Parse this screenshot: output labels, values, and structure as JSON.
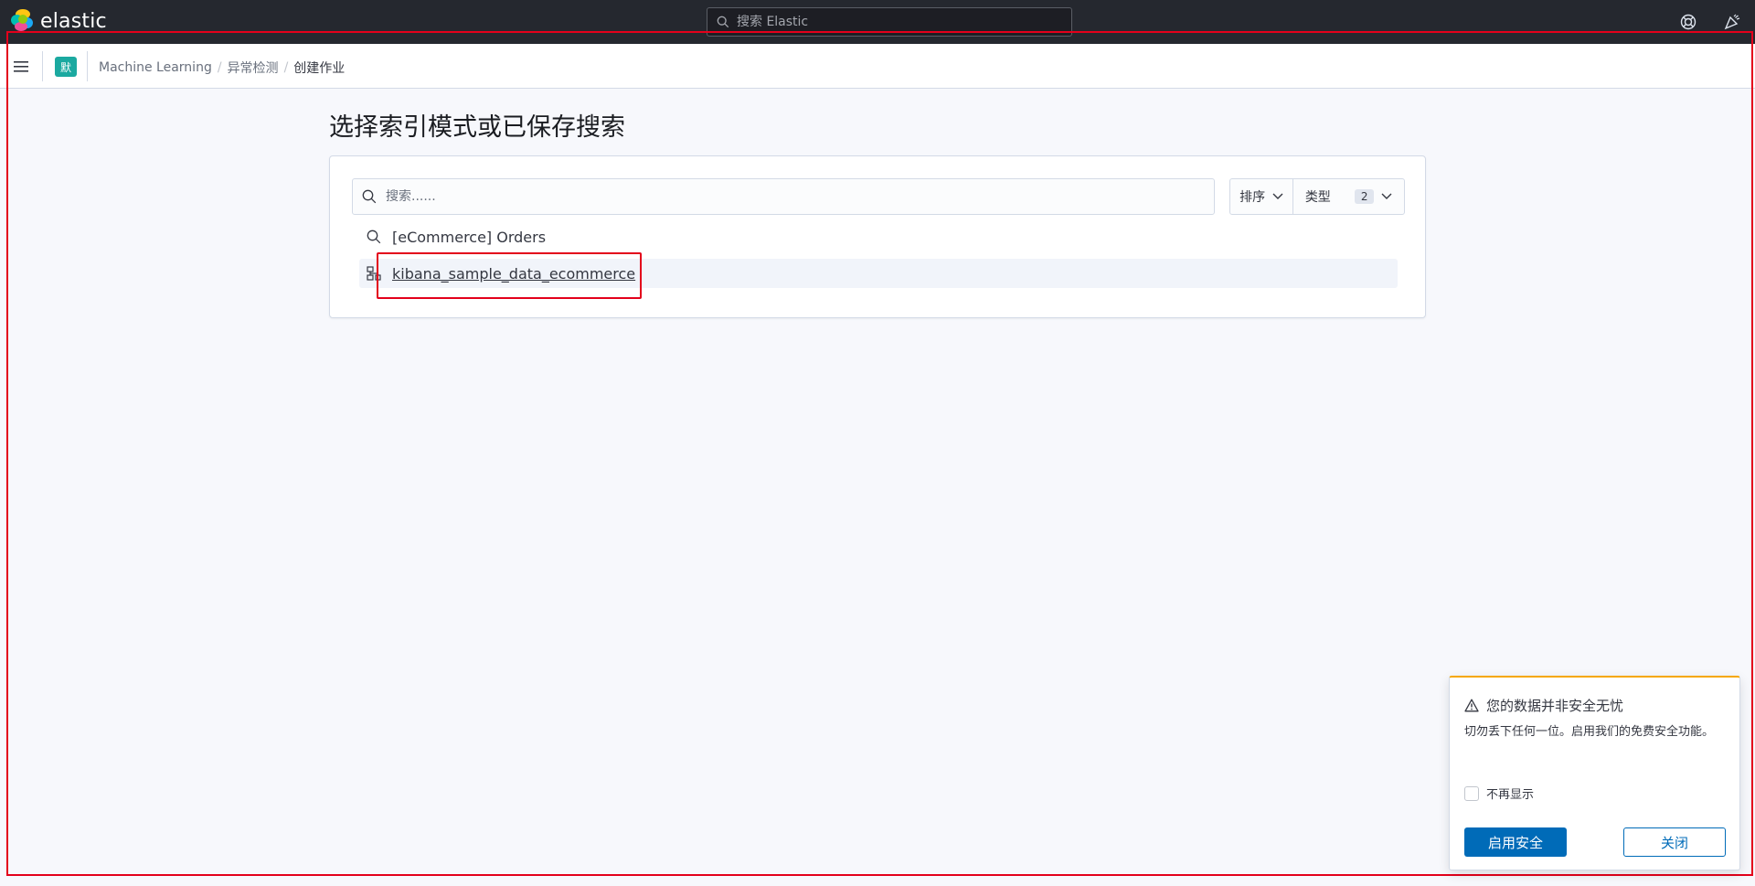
{
  "header": {
    "brand": "elastic",
    "search_placeholder": "搜索 Elastic"
  },
  "breadcrumbs": {
    "space_initial": "默",
    "items": [
      "Machine Learning",
      "异常检测",
      "创建作业"
    ]
  },
  "main": {
    "title": "选择索引模式或已保存搜索",
    "search_placeholder": "搜索......",
    "sort_label": "排序",
    "type_label": "类型",
    "type_count": "2",
    "results": [
      {
        "label": "[eCommerce] Orders",
        "icon": "search-icon"
      },
      {
        "label": "kibana_sample_data_ecommerce",
        "icon": "index-pattern-icon"
      }
    ]
  },
  "toast": {
    "title": "您的数据并非安全无忧",
    "body": "切勿丢下任何一位。启用我们的免费安全功能。",
    "checkbox_label": "不再显示",
    "primary_button": "启用安全",
    "secondary_button": "关闭",
    "accent_color": "#f5a700"
  },
  "colors": {
    "header_bg": "#25282f",
    "primary": "#006bb8",
    "annotation": "#e3001b"
  }
}
